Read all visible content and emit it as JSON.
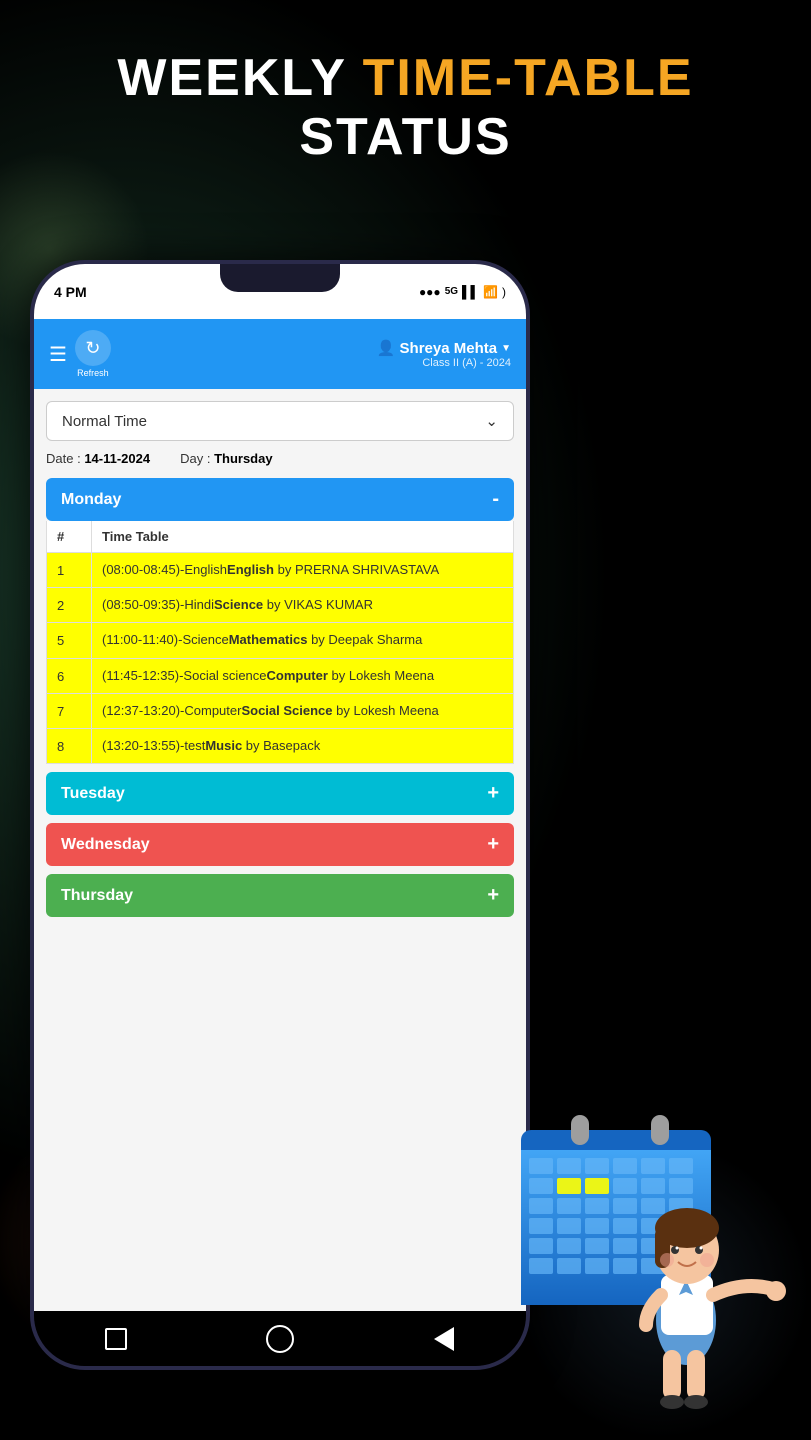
{
  "title": {
    "line1_white": "WEEKLY ",
    "line1_orange": "TIME-TABLE",
    "line2": "STATUS"
  },
  "phone": {
    "status_bar": {
      "time": "4 PM",
      "icons": "●●● 5G ▌▌ WiFi )"
    },
    "header": {
      "user_name": "Shreya Mehta",
      "class_info": "Class II (A) - 2024",
      "refresh_label": "Refresh"
    },
    "dropdown": {
      "value": "Normal Time",
      "placeholder": "Normal Time"
    },
    "date_info": {
      "date_label": "Date :",
      "date_value": "14-11-2024",
      "day_label": "Day :",
      "day_value": "Thursday"
    },
    "days": [
      {
        "name": "Monday",
        "expanded": true,
        "toggle": "-",
        "rows": [
          {
            "num": "1",
            "content_prefix": "(08:00-08:45)-English",
            "content_subject": "English",
            "content_suffix": " by PRERNA SHRIVASTAVA"
          },
          {
            "num": "2",
            "content_prefix": "(08:50-09:35)-Hindi",
            "content_subject": "Science",
            "content_suffix": " by VIKAS KUMAR"
          },
          {
            "num": "5",
            "content_prefix": "(11:00-11:40)-Science",
            "content_subject": "Mathematics",
            "content_suffix": " by Deepak Sharma"
          },
          {
            "num": "6",
            "content_prefix": "(11:45-12:35)-Social science",
            "content_subject": "Computer",
            "content_suffix": " by Lokesh Meena"
          },
          {
            "num": "7",
            "content_prefix": "(12:37-13:20)-Computer",
            "content_subject": "Social Science",
            "content_suffix": " by Lokesh Meena"
          },
          {
            "num": "8",
            "content_prefix": "(13:20-13:55)-test",
            "content_subject": "Music",
            "content_suffix": " by Basepack"
          }
        ]
      },
      {
        "name": "Tuesday",
        "expanded": false,
        "toggle": "+"
      },
      {
        "name": "Wednesday",
        "expanded": false,
        "toggle": "+"
      },
      {
        "name": "Thursday",
        "expanded": false,
        "toggle": "+"
      }
    ],
    "table_header": {
      "col1": "#",
      "col2": "Time Table"
    }
  }
}
